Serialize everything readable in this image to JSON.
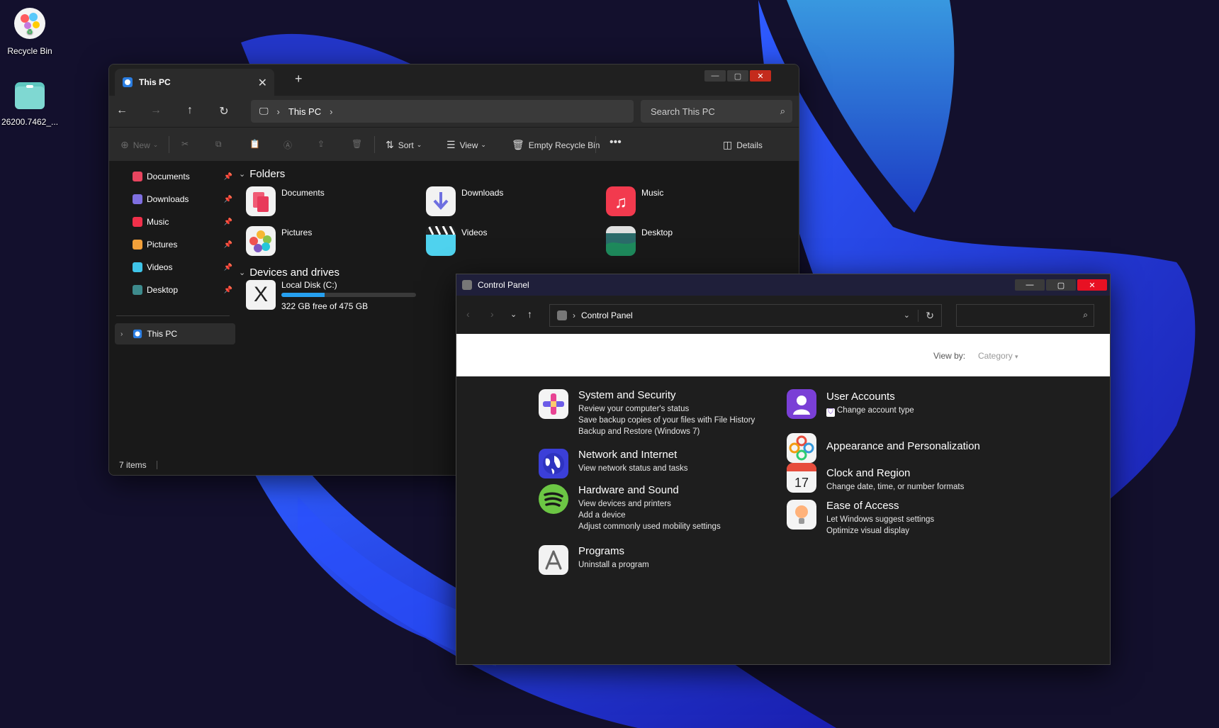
{
  "desktop": {
    "icons": [
      {
        "label": "Recycle Bin"
      },
      {
        "label": "26200.7462_..."
      }
    ]
  },
  "explorer": {
    "tab_title": "This PC",
    "new_tab": "+",
    "breadcrumb": {
      "location": "This PC"
    },
    "search_placeholder": "Search This PC",
    "toolbar": {
      "new": "New",
      "sort": "Sort",
      "view": "View",
      "empty_recycle_bin": "Empty Recycle Bin",
      "more": "•••",
      "details": "Details"
    },
    "sidebar": {
      "items": [
        {
          "label": "Documents",
          "color": "#e8455f"
        },
        {
          "label": "Downloads",
          "color": "#7f6fe0"
        },
        {
          "label": "Music",
          "color": "#f0304a"
        },
        {
          "label": "Pictures",
          "color": "#f2a03a"
        },
        {
          "label": "Videos",
          "color": "#3fc4e8"
        },
        {
          "label": "Desktop",
          "color": "#3d8a8c"
        }
      ],
      "this_pc": "This PC"
    },
    "sections": {
      "folders": "Folders",
      "devices": "Devices and drives"
    },
    "folders": [
      {
        "label": "Documents"
      },
      {
        "label": "Downloads"
      },
      {
        "label": "Music"
      },
      {
        "label": "Pictures"
      },
      {
        "label": "Videos"
      },
      {
        "label": "Desktop"
      }
    ],
    "drive": {
      "label": "Local Disk (C:)",
      "free_text": "322 GB free of 475 GB",
      "used_fraction": 0.322
    },
    "status": "7 items"
  },
  "control_panel": {
    "title": "Control Panel",
    "address": "Control Panel",
    "view_by_label": "View by:",
    "view_by_value": "Category",
    "categories": [
      {
        "title": "System and Security",
        "links": [
          "Review your computer's status",
          "Save backup copies of your files with File History",
          "Backup and Restore (Windows 7)"
        ]
      },
      {
        "title": "Network and Internet",
        "links": [
          "View network status and tasks"
        ]
      },
      {
        "title": "Hardware and Sound",
        "links": [
          "View devices and printers",
          "Add a device",
          "Adjust commonly used mobility settings"
        ]
      },
      {
        "title": "Programs",
        "links": [
          "Uninstall a program"
        ]
      },
      {
        "title": "User Accounts",
        "links": [
          "Change account type"
        ]
      },
      {
        "title": "Appearance and Personalization",
        "links": []
      },
      {
        "title": "Clock and Region",
        "links": [
          "Change date, time, or number formats"
        ]
      },
      {
        "title": "Ease of Access",
        "links": [
          "Let Windows suggest settings",
          "Optimize visual display"
        ]
      }
    ],
    "clock_icon_day": "17"
  }
}
